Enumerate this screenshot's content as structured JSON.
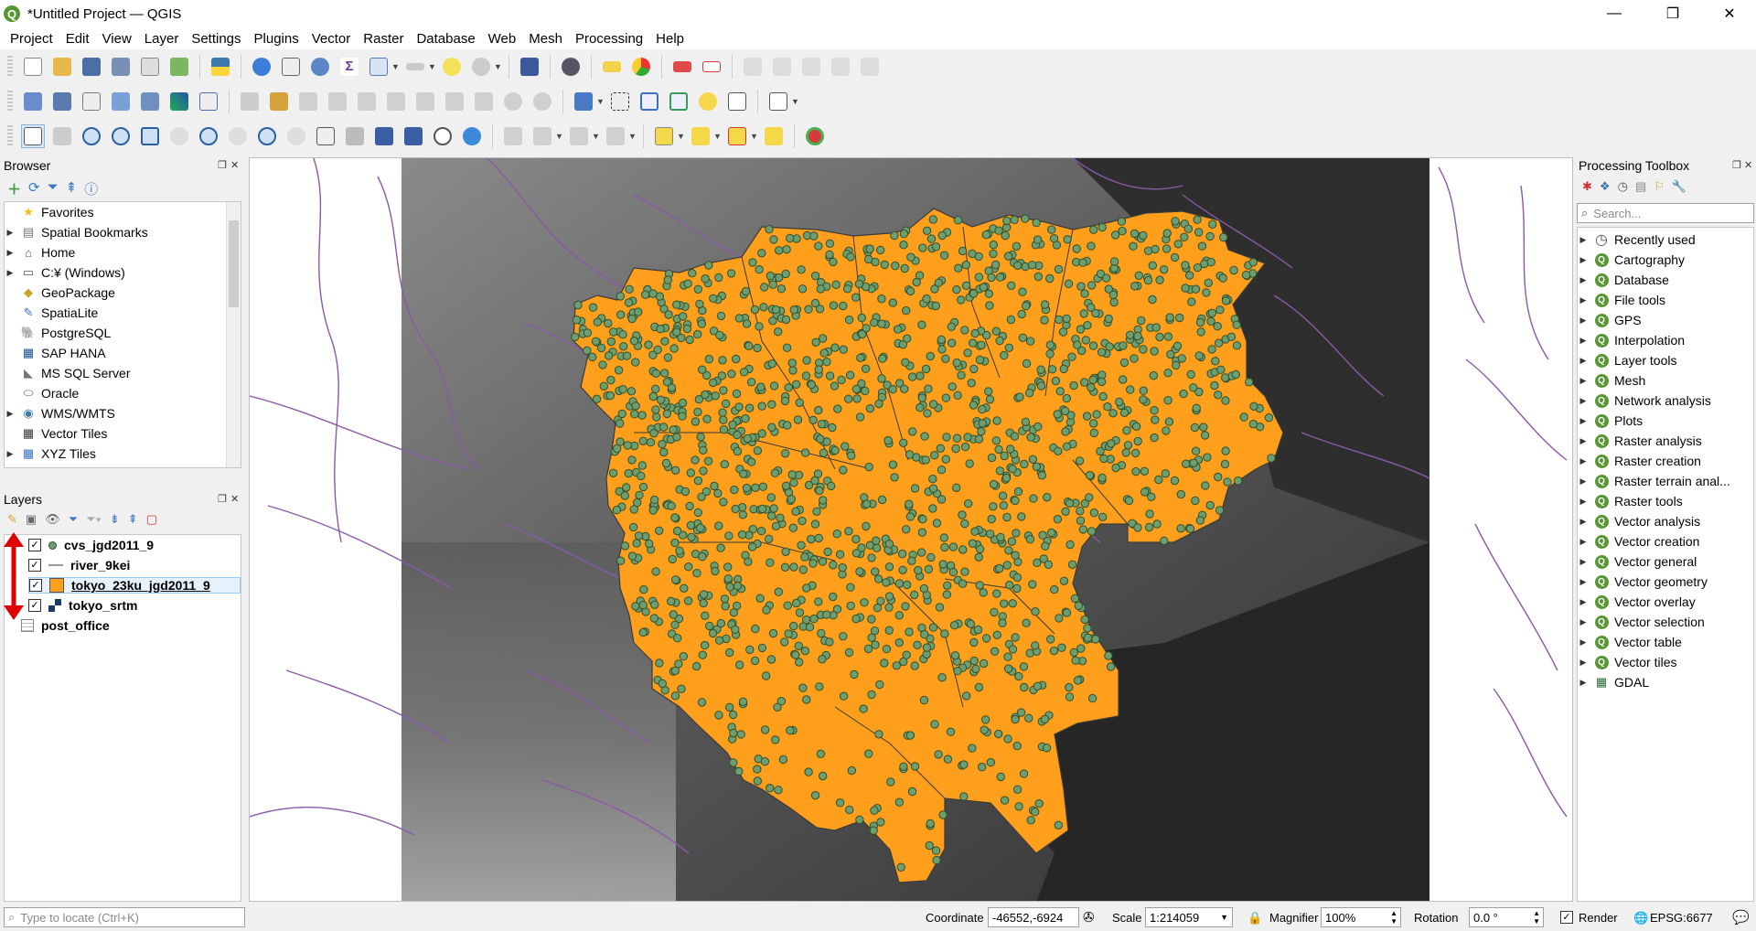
{
  "window": {
    "title": "*Untitled Project — QGIS",
    "controls": {
      "minimize": "—",
      "maximize": "❐",
      "close": "✕"
    }
  },
  "menubar": {
    "items": [
      "Project",
      "Edit",
      "View",
      "Layer",
      "Settings",
      "Plugins",
      "Vector",
      "Raster",
      "Database",
      "Web",
      "Mesh",
      "Processing",
      "Help"
    ]
  },
  "browser": {
    "title": "Browser",
    "items": [
      {
        "label": "Favorites",
        "icon": "star-icon",
        "expandable": false
      },
      {
        "label": "Spatial Bookmarks",
        "icon": "bookmark-icon",
        "expandable": true
      },
      {
        "label": "Home",
        "icon": "home-icon",
        "expandable": true
      },
      {
        "label": "C:¥ (Windows)",
        "icon": "drive-icon",
        "expandable": true
      },
      {
        "label": "GeoPackage",
        "icon": "geopackage-icon",
        "expandable": false
      },
      {
        "label": "SpatiaLite",
        "icon": "spatialite-icon",
        "expandable": false
      },
      {
        "label": "PostgreSQL",
        "icon": "postgresql-icon",
        "expandable": false
      },
      {
        "label": "SAP HANA",
        "icon": "sap-hana-icon",
        "expandable": false
      },
      {
        "label": "MS SQL Server",
        "icon": "mssql-icon",
        "expandable": false
      },
      {
        "label": "Oracle",
        "icon": "oracle-icon",
        "expandable": false
      },
      {
        "label": "WMS/WMTS",
        "icon": "wms-icon",
        "expandable": true
      },
      {
        "label": "Vector Tiles",
        "icon": "vector-tiles-icon",
        "expandable": false
      },
      {
        "label": "XYZ Tiles",
        "icon": "xyz-tiles-icon",
        "expandable": true
      }
    ]
  },
  "layers": {
    "title": "Layers",
    "items": [
      {
        "name": "cvs_jgd2011_9",
        "checked": true,
        "symbol": "point",
        "color": "#6e9e6e",
        "selected": false
      },
      {
        "name": "river_9kei",
        "checked": true,
        "symbol": "line",
        "color": "#999999",
        "selected": false
      },
      {
        "name": "tokyo_23ku_jgd2011_9",
        "checked": true,
        "symbol": "polygon",
        "color": "#ff9f1c",
        "selected": true
      },
      {
        "name": "tokyo_srtm",
        "checked": true,
        "symbol": "raster",
        "color": "#1a3a6a",
        "selected": false
      },
      {
        "name": "post_office",
        "checked": false,
        "symbol": "table",
        "color": "#888888",
        "selected": false
      }
    ],
    "drag_arrow_color": "#e00000"
  },
  "processing": {
    "title": "Processing Toolbox",
    "search_placeholder": "Search...",
    "items": [
      {
        "label": "Recently used",
        "icon": "clock-icon"
      },
      {
        "label": "Cartography",
        "icon": "qgis-icon"
      },
      {
        "label": "Database",
        "icon": "qgis-icon"
      },
      {
        "label": "File tools",
        "icon": "qgis-icon"
      },
      {
        "label": "GPS",
        "icon": "qgis-icon"
      },
      {
        "label": "Interpolation",
        "icon": "qgis-icon"
      },
      {
        "label": "Layer tools",
        "icon": "qgis-icon"
      },
      {
        "label": "Mesh",
        "icon": "qgis-icon"
      },
      {
        "label": "Network analysis",
        "icon": "qgis-icon"
      },
      {
        "label": "Plots",
        "icon": "qgis-icon"
      },
      {
        "label": "Raster analysis",
        "icon": "qgis-icon"
      },
      {
        "label": "Raster creation",
        "icon": "qgis-icon"
      },
      {
        "label": "Raster terrain anal...",
        "icon": "qgis-icon"
      },
      {
        "label": "Raster tools",
        "icon": "qgis-icon"
      },
      {
        "label": "Vector analysis",
        "icon": "qgis-icon"
      },
      {
        "label": "Vector creation",
        "icon": "qgis-icon"
      },
      {
        "label": "Vector general",
        "icon": "qgis-icon"
      },
      {
        "label": "Vector geometry",
        "icon": "qgis-icon"
      },
      {
        "label": "Vector overlay",
        "icon": "qgis-icon"
      },
      {
        "label": "Vector selection",
        "icon": "qgis-icon"
      },
      {
        "label": "Vector table",
        "icon": "qgis-icon"
      },
      {
        "label": "Vector tiles",
        "icon": "qgis-icon"
      },
      {
        "label": "GDAL",
        "icon": "gdal-icon"
      }
    ]
  },
  "map": {
    "colors": {
      "polygon_fill": "#ff9f1c",
      "polygon_stroke": "#3a3a3a",
      "point_fill": "#6e9e6e",
      "point_stroke": "#2f4f2f",
      "river": "#8a5aa8",
      "raster_dark": "#262626"
    }
  },
  "status": {
    "locator_placeholder": "Type to locate (Ctrl+K)",
    "coordinate_label": "Coordinate",
    "coordinate_value": "-46552,-6924",
    "scale_label": "Scale",
    "scale_value": "1:214059",
    "magnifier_label": "Magnifier",
    "magnifier_value": "100%",
    "rotation_label": "Rotation",
    "rotation_value": "0.0 °",
    "render_label": "Render",
    "crs": "EPSG:6677"
  }
}
